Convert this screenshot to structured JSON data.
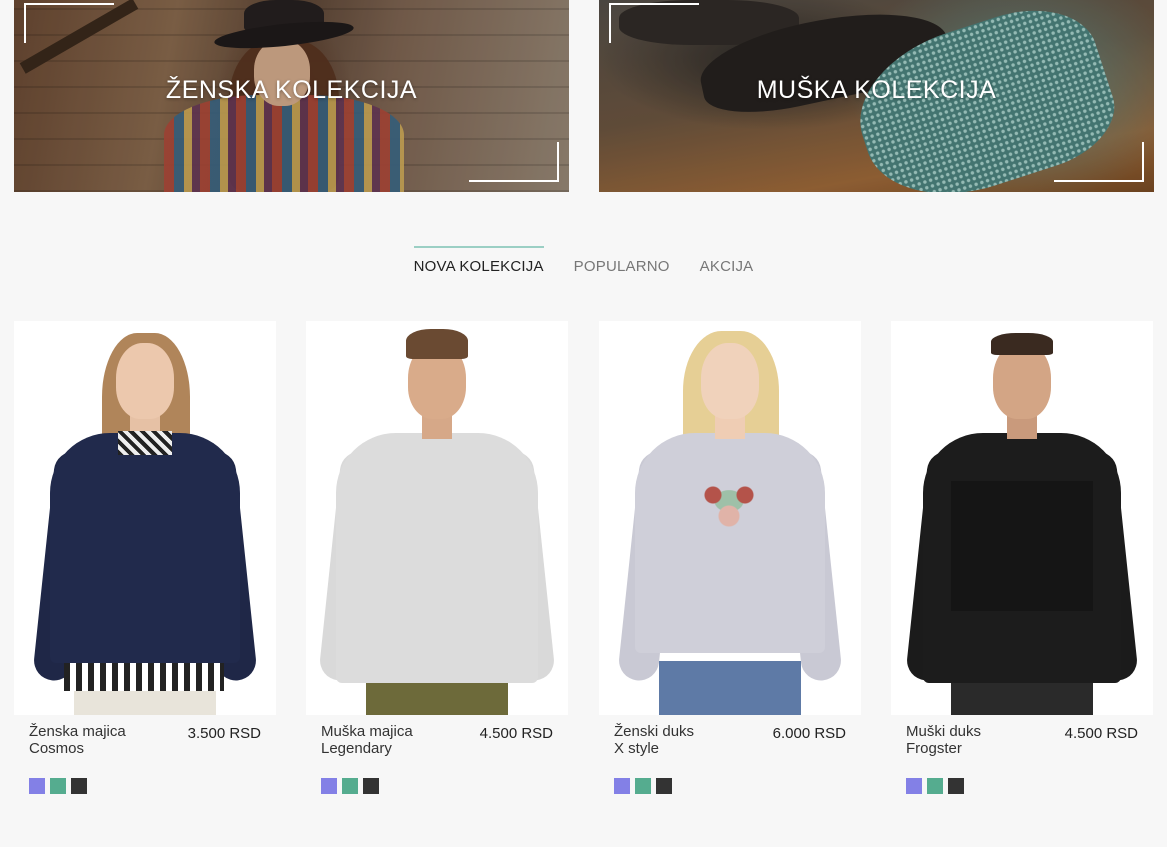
{
  "banners": [
    {
      "title": "ŽENSKA KOLEKCIJA"
    },
    {
      "title": "MUŠKA KOLEKCIJA"
    }
  ],
  "tabs": [
    {
      "label": "NOVA KOLEKCIJA",
      "active": true
    },
    {
      "label": "POPULARNO",
      "active": false
    },
    {
      "label": "AKCIJA",
      "active": false
    }
  ],
  "products": [
    {
      "name_line1": "Ženska majica",
      "name_line2": "Cosmos",
      "price": "3.500 RSD"
    },
    {
      "name_line1": "Muška majica",
      "name_line2": "Legendary",
      "price": "4.500 RSD"
    },
    {
      "name_line1": "Ženski duks",
      "name_line2": "X style",
      "price": "6.000 RSD"
    },
    {
      "name_line1": "Muški duks",
      "name_line2": "Frogster",
      "price": "4.500 RSD"
    }
  ],
  "swatch_colors": [
    "#8380e6",
    "#55ac8f",
    "#333333"
  ],
  "colors": {
    "accent": "#9bcfc4",
    "background": "#f7f7f7"
  }
}
